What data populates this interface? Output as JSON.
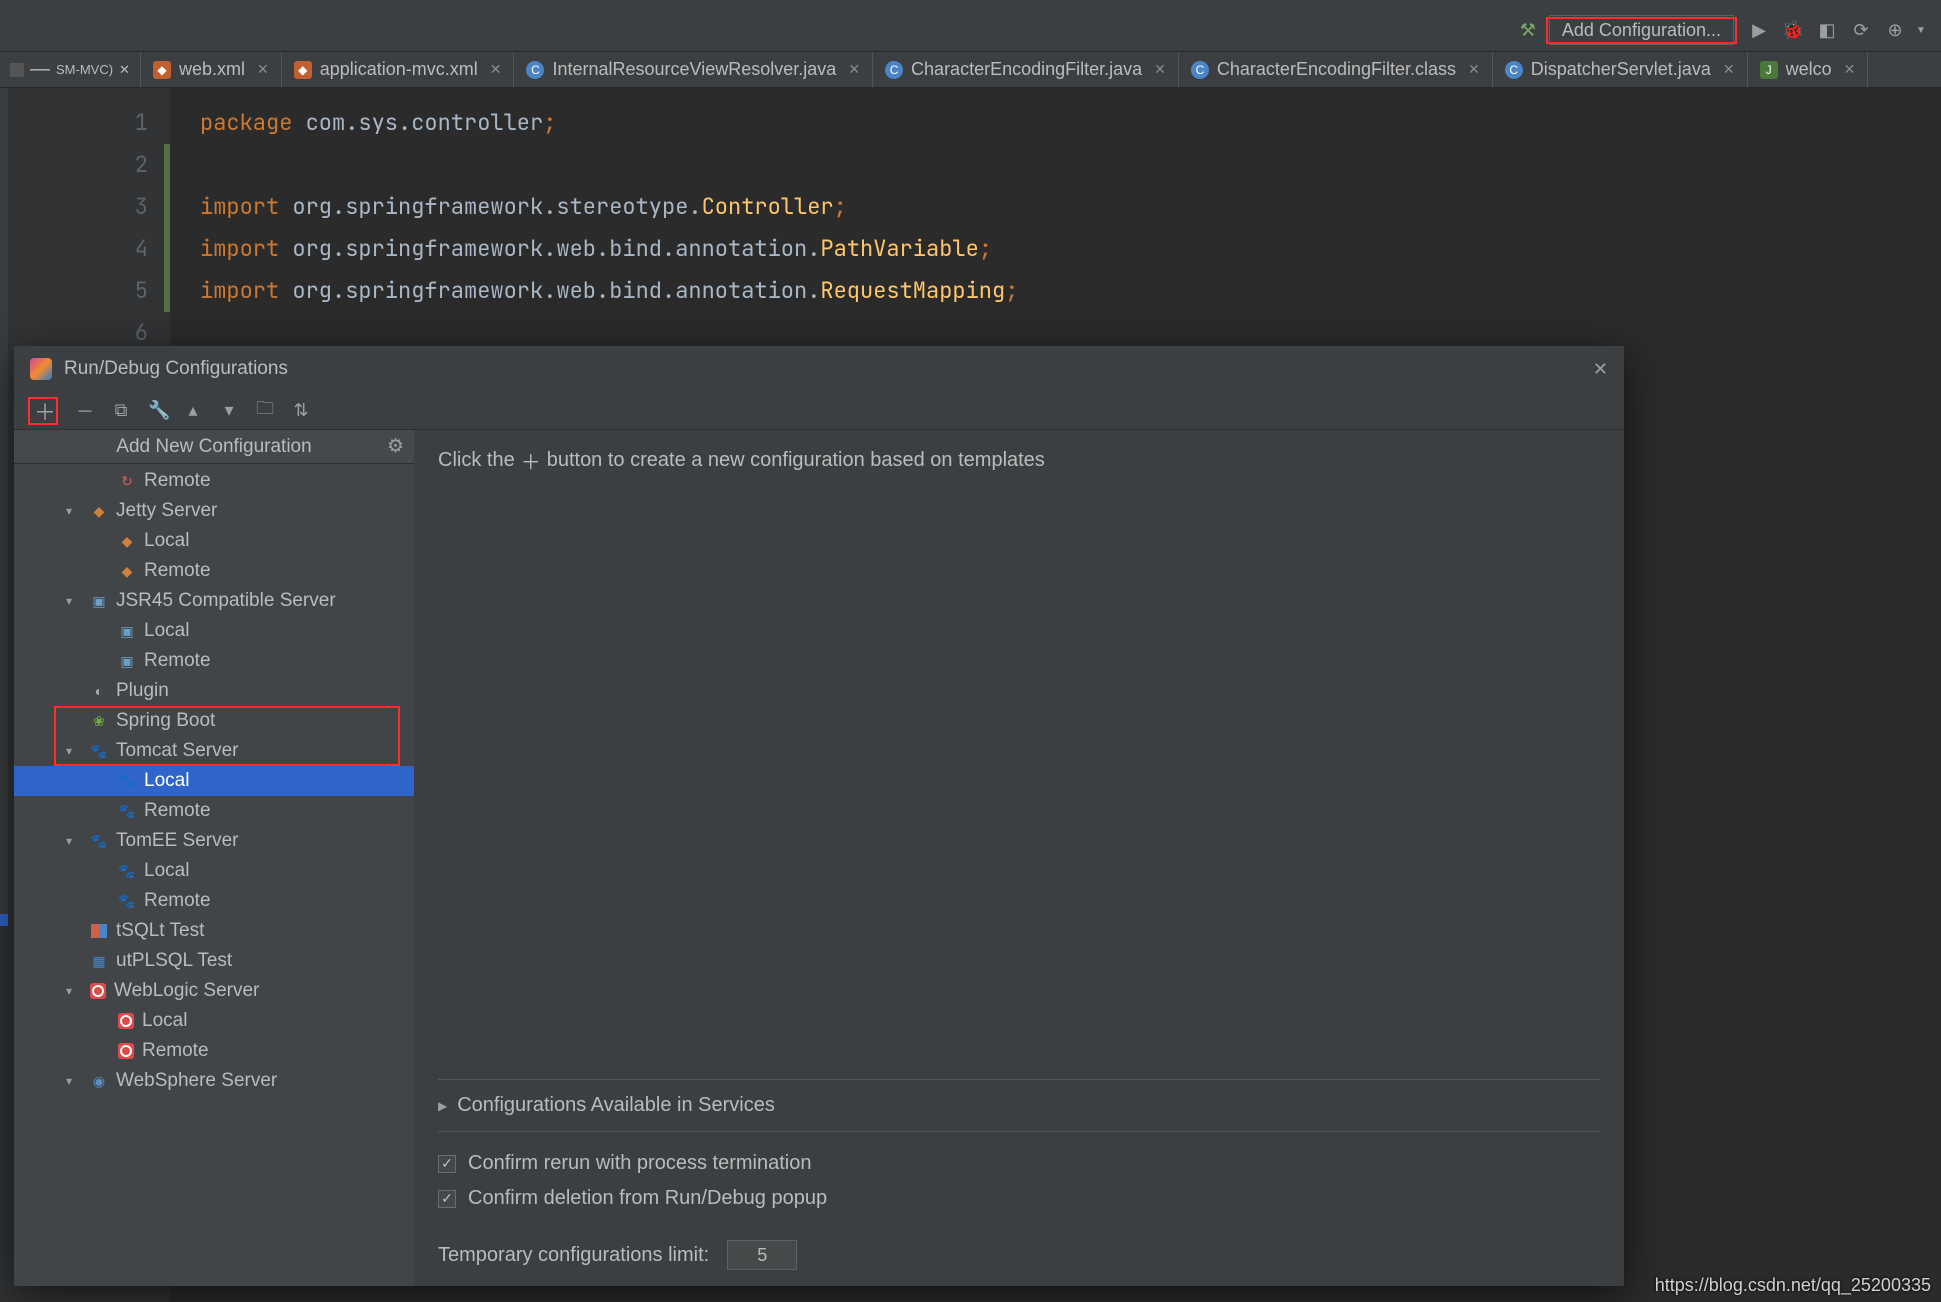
{
  "toolbar": {
    "add_config": "Add Configuration..."
  },
  "tabs": {
    "left_label": "SM-MVC)",
    "items": [
      {
        "label": "web.xml",
        "kind": "xml"
      },
      {
        "label": "application-mvc.xml",
        "kind": "xml"
      },
      {
        "label": "InternalResourceViewResolver.java",
        "kind": "java"
      },
      {
        "label": "CharacterEncodingFilter.java",
        "kind": "java"
      },
      {
        "label": "CharacterEncodingFilter.class",
        "kind": "class"
      },
      {
        "label": "DispatcherServlet.java",
        "kind": "java"
      },
      {
        "label": "welco",
        "kind": "jsp"
      }
    ]
  },
  "code": {
    "lines": [
      {
        "n": "1",
        "pre": "",
        "kw": "package",
        "mid": " com.sys.controller",
        "semi": ";",
        "cls": ""
      },
      {
        "n": "2",
        "pre": "",
        "kw": "",
        "mid": "",
        "semi": "",
        "cls": ""
      },
      {
        "n": "3",
        "pre": "",
        "kw": "import",
        "mid": " org.springframework.stereotype.",
        "semi": ";",
        "cls": "Controller"
      },
      {
        "n": "4",
        "pre": "",
        "kw": "import",
        "mid": " org.springframework.web.bind.annotation.",
        "semi": ";",
        "cls": "PathVariable"
      },
      {
        "n": "5",
        "pre": "",
        "kw": "import",
        "mid": " org.springframework.web.bind.annotation.",
        "semi": ";",
        "cls": "RequestMapping"
      },
      {
        "n": "6",
        "pre": "",
        "kw": "",
        "mid": "",
        "semi": "",
        "cls": ""
      }
    ]
  },
  "dialog": {
    "title": "Run/Debug Configurations",
    "side_header": "Add New Configuration",
    "tree": [
      {
        "level": "grandchild",
        "icon": "remote-red",
        "label": "Remote",
        "arrow": ""
      },
      {
        "level": "child",
        "icon": "jetty",
        "label": "Jetty Server",
        "arrow": "▾"
      },
      {
        "level": "grandchild",
        "icon": "jetty",
        "label": "Local",
        "arrow": ""
      },
      {
        "level": "grandchild",
        "icon": "jetty",
        "label": "Remote",
        "arrow": ""
      },
      {
        "level": "child",
        "icon": "jsr",
        "label": "JSR45 Compatible Server",
        "arrow": "▾"
      },
      {
        "level": "grandchild",
        "icon": "jsr",
        "label": "Local",
        "arrow": ""
      },
      {
        "level": "grandchild",
        "icon": "jsr",
        "label": "Remote",
        "arrow": ""
      },
      {
        "level": "child",
        "icon": "plugin",
        "label": "Plugin",
        "arrow": ""
      },
      {
        "level": "child",
        "icon": "spring",
        "label": "Spring Boot",
        "arrow": ""
      },
      {
        "level": "child",
        "icon": "tomcat",
        "label": "Tomcat Server",
        "arrow": "▾"
      },
      {
        "level": "grandchild",
        "icon": "tomcat",
        "label": "Local",
        "arrow": "",
        "selected": true
      },
      {
        "level": "grandchild",
        "icon": "tomcat",
        "label": "Remote",
        "arrow": ""
      },
      {
        "level": "child",
        "icon": "tomcat",
        "label": "TomEE Server",
        "arrow": "▾"
      },
      {
        "level": "grandchild",
        "icon": "tomcat",
        "label": "Local",
        "arrow": ""
      },
      {
        "level": "grandchild",
        "icon": "tomcat",
        "label": "Remote",
        "arrow": ""
      },
      {
        "level": "child",
        "icon": "tsq",
        "label": "tSQLt Test",
        "arrow": ""
      },
      {
        "level": "child",
        "icon": "ut",
        "label": "utPLSQL Test",
        "arrow": ""
      },
      {
        "level": "child",
        "icon": "wl",
        "label": "WebLogic Server",
        "arrow": "▾"
      },
      {
        "level": "grandchild",
        "icon": "wl",
        "label": "Local",
        "arrow": ""
      },
      {
        "level": "grandchild",
        "icon": "wl",
        "label": "Remote",
        "arrow": ""
      },
      {
        "level": "child",
        "icon": "ws",
        "label": "WebSphere Server",
        "arrow": "▾"
      }
    ],
    "hint_pre": "Click the ",
    "hint_post": " button to create a new configuration based on templates",
    "section": "Configurations Available in Services",
    "chk1": "Confirm rerun with process termination",
    "chk2": "Confirm deletion from Run/Debug popup",
    "limit_label": "Temporary configurations limit:",
    "limit_value": "5"
  },
  "footer": "https://blog.csdn.net/qq_25200335"
}
